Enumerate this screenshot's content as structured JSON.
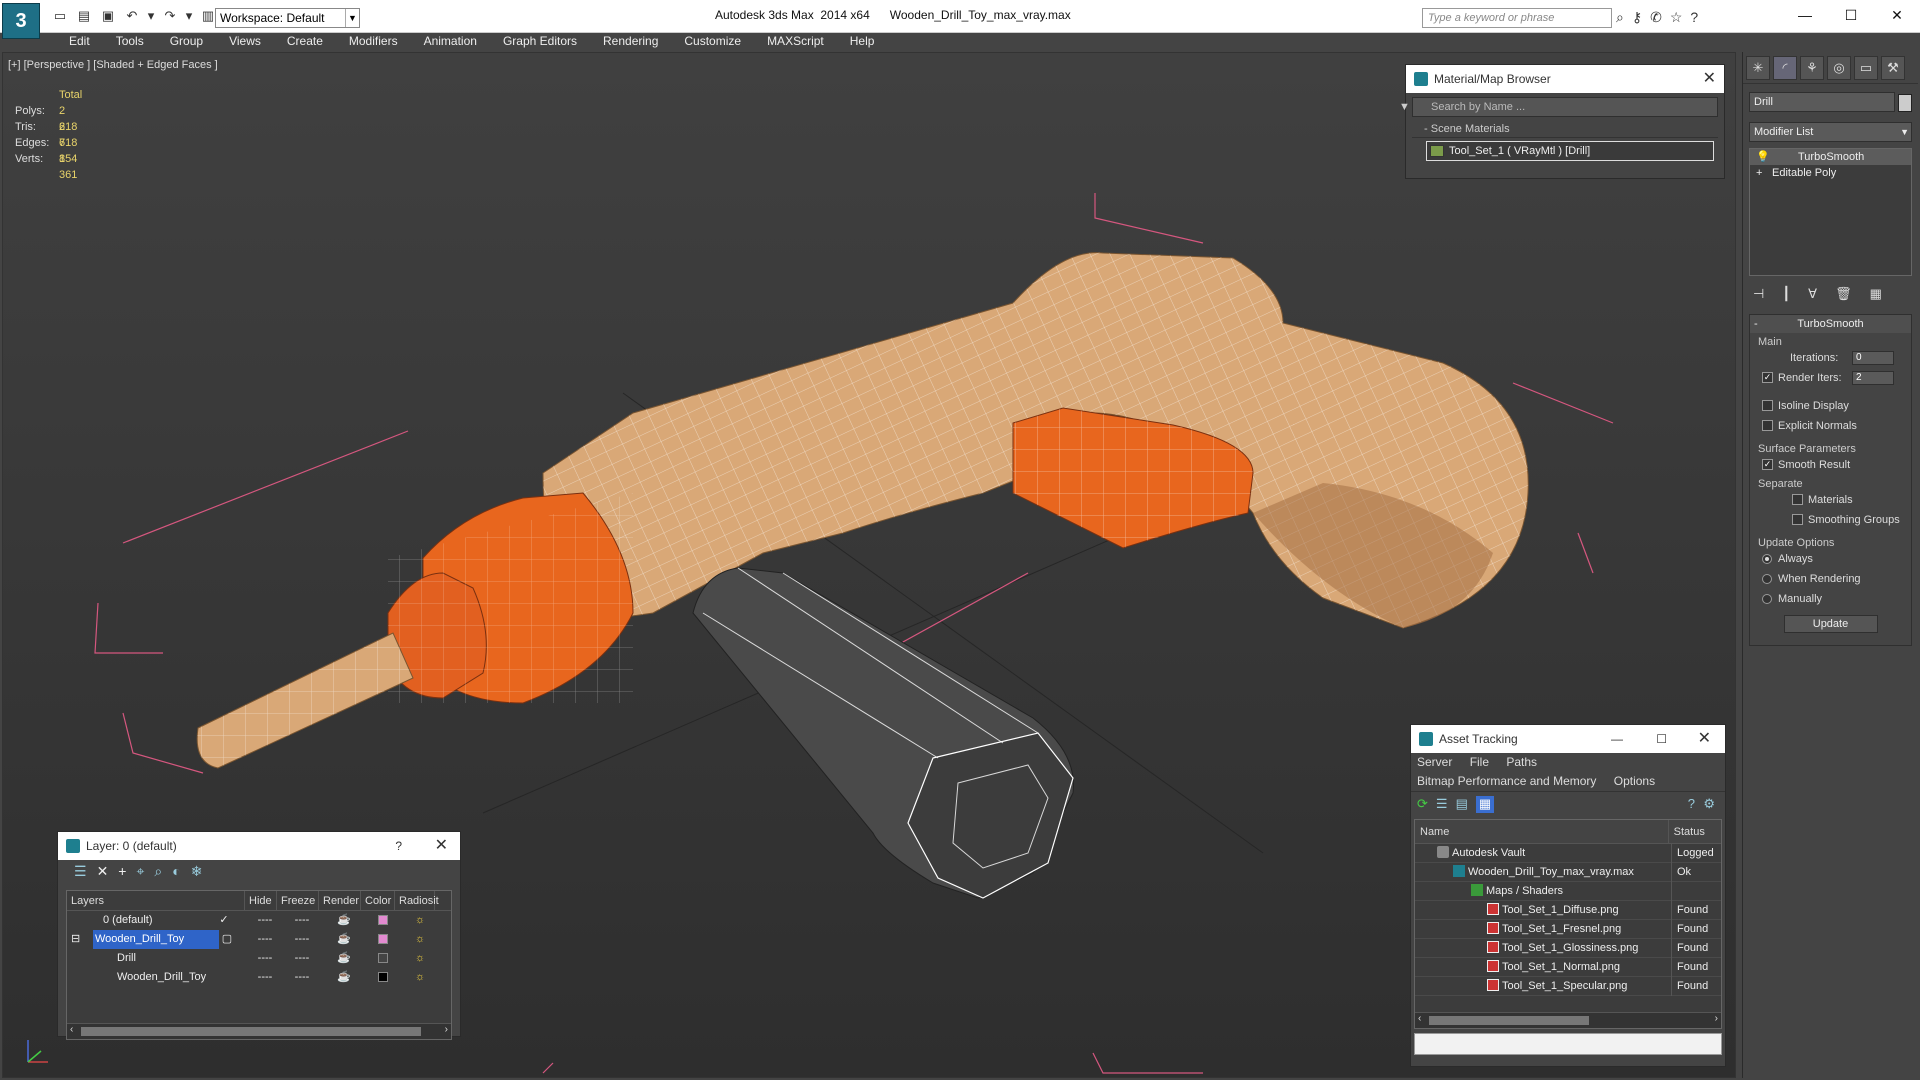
{
  "titlebar": {
    "app_title": "Autodesk 3ds Max  2014 x64      Wooden_Drill_Toy_max_vray.max",
    "workspace": "Workspace: Default",
    "search_placeholder": "Type a keyword or phrase",
    "logo": "3"
  },
  "menu": [
    "Edit",
    "Tools",
    "Group",
    "Views",
    "Create",
    "Modifiers",
    "Animation",
    "Graph Editors",
    "Rendering",
    "Customize",
    "MAXScript",
    "Help"
  ],
  "viewport": {
    "label": "[+] [Perspective ] [Shaded + Edged Faces ]",
    "stats": {
      "total_label": "Total",
      "rows": [
        {
          "label": "Polys:",
          "value": "2 618"
        },
        {
          "label": "Tris:",
          "value": "2 618"
        },
        {
          "label": "Edges:",
          "value": "7 854"
        },
        {
          "label": "Verts:",
          "value": "1 361"
        }
      ]
    }
  },
  "material_browser": {
    "title": "Material/Map Browser",
    "search_placeholder": "Search by Name ...",
    "section": "Scene Materials",
    "item": "Tool_Set_1 ( VRayMtl ) [Drill]"
  },
  "command_panel": {
    "object_name": "Drill",
    "modifier_list": "Modifier List",
    "stack": [
      "TurboSmooth",
      "Editable Poly"
    ],
    "turbosmooth": {
      "header": "TurboSmooth",
      "main_label": "Main",
      "iterations_label": "Iterations:",
      "iterations_value": "0",
      "render_iters_label": "Render Iters:",
      "render_iters_value": "2",
      "isoline": "Isoline Display",
      "explicit": "Explicit Normals",
      "surface_title": "Surface Parameters",
      "smooth_result": "Smooth Result",
      "separate": "Separate",
      "materials": "Materials",
      "smoothing_groups": "Smoothing Groups",
      "update_title": "Update Options",
      "always": "Always",
      "when_rendering": "When Rendering",
      "manually": "Manually",
      "update_btn": "Update"
    }
  },
  "layer_window": {
    "title": "Layer: 0 (default)",
    "columns": [
      "Layers",
      "Hide",
      "Freeze",
      "Render",
      "Color",
      "Radiosit"
    ],
    "rows": [
      {
        "name": "0 (default)",
        "color": "#e28ad0"
      },
      {
        "name": "Wooden_Drill_Toy",
        "color": "#e28ad0"
      },
      {
        "name": "Drill",
        "color": "#444444"
      },
      {
        "name": "Wooden_Drill_Toy",
        "color": "#000000"
      }
    ]
  },
  "asset_tracking": {
    "title": "Asset Tracking",
    "menu1": [
      "Server",
      "File",
      "Paths"
    ],
    "menu2": [
      "Bitmap Performance and Memory",
      "Options"
    ],
    "columns": [
      "Name",
      "Status"
    ],
    "rows": [
      {
        "name": "Autodesk Vault",
        "status": "Logged",
        "icon": "vault"
      },
      {
        "name": "Wooden_Drill_Toy_max_vray.max",
        "status": "Ok",
        "icon": "max"
      },
      {
        "name": "Maps / Shaders",
        "status": "",
        "icon": "maps"
      },
      {
        "name": "Tool_Set_1_Diffuse.png",
        "status": "Found",
        "icon": "png"
      },
      {
        "name": "Tool_Set_1_Fresnel.png",
        "status": "Found",
        "icon": "png"
      },
      {
        "name": "Tool_Set_1_Glossiness.png",
        "status": "Found",
        "icon": "png"
      },
      {
        "name": "Tool_Set_1_Normal.png",
        "status": "Found",
        "icon": "png"
      },
      {
        "name": "Tool_Set_1_Specular.png",
        "status": "Found",
        "icon": "png"
      }
    ]
  },
  "colors": {
    "wood": "#d9a877",
    "orange": "#e8661e",
    "grip": "#4a4a4a",
    "bbox": "#d5577f"
  }
}
